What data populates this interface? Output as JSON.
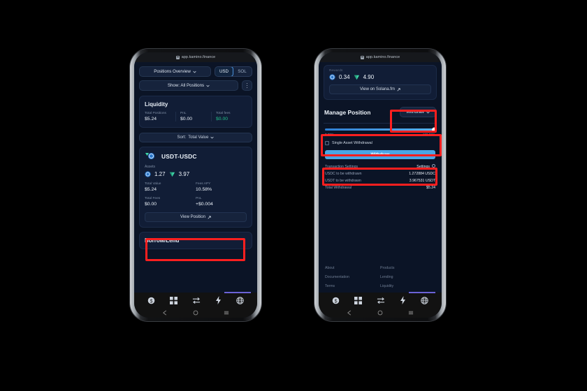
{
  "browser": {
    "url": "app.kamino.finance",
    "lock_icon": "lock-icon"
  },
  "left_phone": {
    "toolbar": {
      "positions_overview": "Positions Overview",
      "chevron_icon": "chevron-down-icon",
      "currency_usd": "USD",
      "currency_sol": "SOL",
      "show_filter": "Show: All Positions",
      "kebab_icon": "kebab-menu-icon"
    },
    "liquidity_card": {
      "title": "Liquidity",
      "stats": [
        {
          "label": "Total Positions",
          "value": "$5.24",
          "color": "#e9f0f8"
        },
        {
          "label": "PnL",
          "value": "$0.00",
          "color": "#e9f0f8"
        },
        {
          "label": "Total fees",
          "value": "$0.00",
          "color": "#23c48a"
        }
      ]
    },
    "sort_bar": {
      "label": "Sort:",
      "value": "Total Value",
      "chevron_icon": "chevron-down-icon"
    },
    "position_card": {
      "pair": "USDT-USDC",
      "token_a_icon": "usdt-token-icon",
      "token_b_icon": "usdc-token-icon",
      "assets_label": "Assets",
      "assets": [
        {
          "icon": "usdc-token-icon",
          "amount": "1.27"
        },
        {
          "icon": "usdt-token-icon",
          "amount": "3.97"
        }
      ],
      "metrics": [
        {
          "label": "Total Value",
          "value": "$5.24",
          "color": "#eef4fb"
        },
        {
          "label": "Fees APY",
          "value": "10.58%",
          "color": "#eef4fb"
        },
        {
          "label": "Total Fees",
          "value": "$0.00",
          "color": "#eef4fb"
        },
        {
          "label": "PnL",
          "value": "+$0.004",
          "color": "#23c48a"
        }
      ],
      "view_position": "View Position",
      "external_link_icon": "external-link-icon"
    },
    "borrow_lend": {
      "title": "Borrow/Lend"
    }
  },
  "right_phone": {
    "rewards": {
      "label": "Rewards",
      "items": [
        {
          "icon": "usdc-token-icon",
          "amount": "0.34"
        },
        {
          "icon": "usdt-token-icon",
          "amount": "4.90"
        }
      ],
      "solana_button": "View on Solana.fm",
      "external_link_icon": "external-link-icon"
    },
    "manage_position": {
      "title": "Manage Position",
      "action": "Withdraw",
      "chevron_icon": "chevron-down-icon"
    },
    "slider": {
      "min_label": "0.00%",
      "max_label": "100.00%",
      "value": 100,
      "knob_icon": "slider-knob"
    },
    "single_asset": {
      "label": "Single Asset Withdrawal",
      "checked": false,
      "checkbox_icon": "checkbox-icon"
    },
    "withdraw_button": {
      "label": "Withdraw",
      "color": "#4aa6e6"
    },
    "transaction": {
      "rows": [
        {
          "label": "Transaction Settings",
          "value": "Settings",
          "icon": "gear-icon"
        },
        {
          "label": "USDC to be withdrawn",
          "value": "1.272884 USDC",
          "icon": ""
        },
        {
          "label": "USDT to be withdrawn",
          "value": "3.967531 USDT",
          "icon": ""
        },
        {
          "label": "Total Withdrawal",
          "value": "$5.24",
          "icon": ""
        }
      ]
    },
    "footer": {
      "columns": [
        {
          "heading": "About",
          "links": [
            "Documentation",
            "Terms"
          ]
        },
        {
          "heading": "Products",
          "links": [
            "Lending",
            "Liquidity"
          ]
        }
      ]
    }
  },
  "bottom_nav": {
    "items": [
      {
        "name": "dollar-circle-icon"
      },
      {
        "name": "grid-icon"
      },
      {
        "name": "swap-icon"
      },
      {
        "name": "lightning-icon"
      },
      {
        "name": "globe-icon"
      }
    ],
    "system": [
      {
        "name": "android-back-icon"
      },
      {
        "name": "android-home-icon"
      },
      {
        "name": "android-recents-icon"
      }
    ]
  },
  "annotations": {
    "color": "#ff1f1f",
    "boxes": [
      "view-position-button",
      "withdraw-dropdown",
      "withdraw-slider",
      "withdraw-button"
    ]
  }
}
